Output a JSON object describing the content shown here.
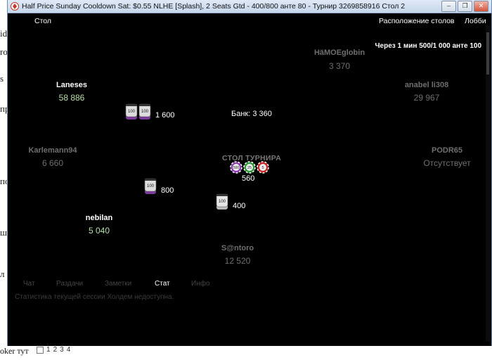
{
  "window": {
    "title": "Half Price Sunday Cooldown Sat: $0.55 NLHE [Splash], 2 Seats Gtd - 400/800 анте 80 - Турнир 3269858916 Стол 2",
    "controls": [
      "–",
      "❐",
      "✕"
    ]
  },
  "menu": {
    "left": "Стол",
    "layout": "Расположение столов",
    "lobby": "Лобби"
  },
  "blinds_notice": "Через 1 мин 500/1 000 анте 100",
  "table_label": "СТОЛ ТУРНИРА",
  "pot": "Банк: 3 360",
  "center_amount": "560",
  "center_chips": [
    "500",
    "25",
    "5"
  ],
  "players": [
    {
      "name": "HäMOEglobin",
      "stack": "3 370",
      "state": "dim"
    },
    {
      "name": "anabel li308",
      "stack": "29 967",
      "state": "dim"
    },
    {
      "name": "Laneses",
      "stack": "58 886",
      "state": "active"
    },
    {
      "name": "Karlemann94",
      "stack": "6 660",
      "state": "dim"
    },
    {
      "name": "PODR65",
      "stack": "Отсутствует",
      "state": "dim"
    },
    {
      "name": "nebilan",
      "stack": "5 040",
      "state": "active"
    },
    {
      "name": "S@ntoro",
      "stack": "12 520",
      "state": "dim"
    }
  ],
  "bets": [
    {
      "amount": "1 600",
      "chip": "100"
    },
    {
      "amount": "800",
      "chip": "100"
    },
    {
      "amount": "400",
      "chip": "100"
    }
  ],
  "tabs": [
    {
      "label": "Чат",
      "active": false
    },
    {
      "label": "Раздачи",
      "active": false
    },
    {
      "label": "Заметки",
      "active": false
    },
    {
      "label": "Стат",
      "active": true
    },
    {
      "label": "Инфо",
      "active": false
    }
  ],
  "stats_message": "Статистика текущей сессии Холдем недоступна.",
  "background": {
    "left_fragments": [
      "id",
      "ro",
      "s",
      "пр",
      "по",
      "ш",
      "л",
      "л р"
    ],
    "bottom_text": "oker тут",
    "pager": [
      "1",
      "2",
      "3",
      "4"
    ]
  },
  "colors": {
    "felt": "#000000",
    "active_stack": "#b6e0a8",
    "inactive": "#6f6f6f"
  }
}
